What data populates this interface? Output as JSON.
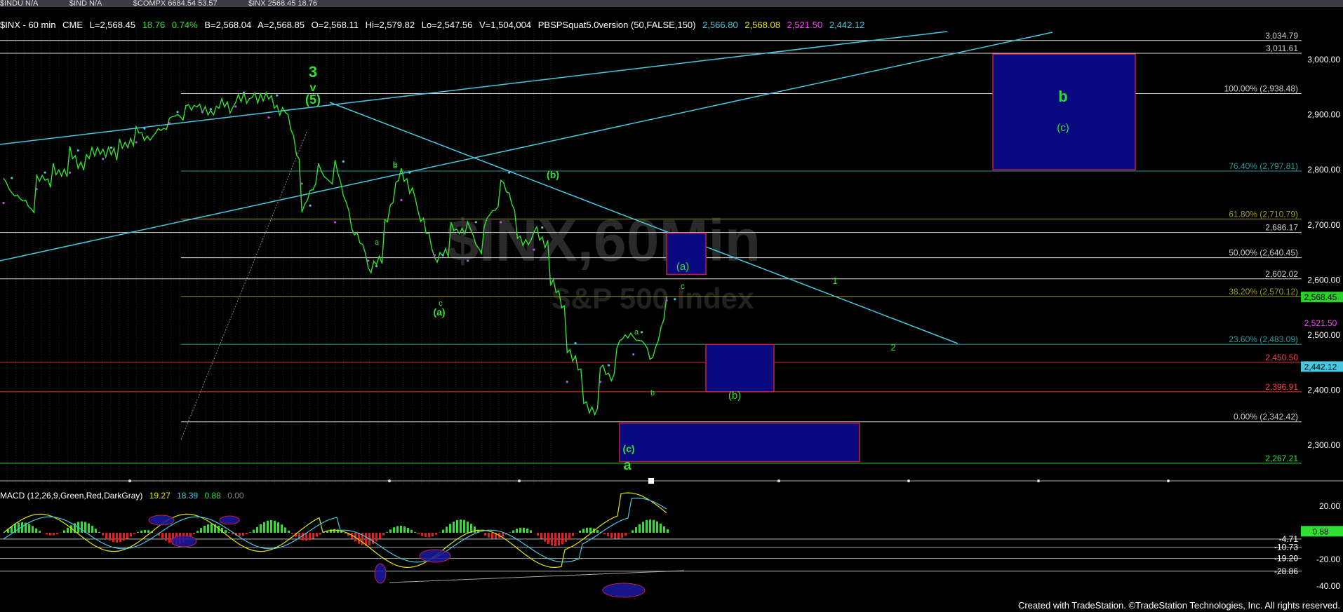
{
  "topbar": [
    "$INDU N/A",
    "$IND N/A",
    "$COMPX 6684.54 53.57",
    "$INX 2568.45 18.76"
  ],
  "header": {
    "symbol": "$INX - 60 min",
    "exchange": "CME",
    "last": "L=2,568.45",
    "change": "18.76",
    "pct": "0.74%",
    "bid": "B=2,568.04",
    "ask": "A=2,568.85",
    "open": "O=2,568.11",
    "high": "Hi=2,579.82",
    "low": "Lo=2,547.56",
    "volume": "V=1,504,004",
    "study": "PBSPSquat5.0version (50,FALSE,150)",
    "study_vals": [
      {
        "text": "2,566.80",
        "color": "#45c8e0"
      },
      {
        "text": "2,568.08",
        "color": "#e6e600"
      },
      {
        "text": "2,521.50",
        "color": "#ff40ff"
      },
      {
        "text": "2,442.12",
        "color": "#45c8e0"
      }
    ]
  },
  "watermark": {
    "title": "$INX,60Min",
    "subtitle": "S&P 500 Index"
  },
  "footer": "Created with TradeStation. ©TradeStation Technologies, Inc. All rights reserved.",
  "macd": {
    "label": "MACD (12,26,9,Green,Red,DarkGray)",
    "vals": [
      {
        "text": "19.27",
        "color": "#e6e600"
      },
      {
        "text": "18.39",
        "color": "#45c8e0"
      },
      {
        "text": "0.88",
        "color": "#30e030"
      },
      {
        "text": "0.00",
        "color": "#808080"
      }
    ],
    "axis": [
      "20.00",
      "-20.00",
      "-40.00"
    ],
    "levels": [
      "-4.71",
      "-10.73",
      "-19.20",
      "-28.86"
    ],
    "last_badge": "0.88"
  },
  "chart_data": {
    "type": "line",
    "title": "$INX - 60 min",
    "ylim": [
      2230,
      3060
    ],
    "y_ticks": [
      "3,000.00",
      "2,900.00",
      "2,800.00",
      "2,700.00",
      "2,600.00",
      "2,500.00",
      "2,400.00",
      "2,300.00"
    ],
    "levels": [
      {
        "label": "3,034.79",
        "value": 3034.79
      },
      {
        "label": "3,011.61",
        "value": 3011.61
      },
      {
        "label": "100.00% (2,938.48)",
        "value": 2938.48
      },
      {
        "label": "76.40% (2,797.81)",
        "value": 2797.81
      },
      {
        "label": "61.80% (2,710.79)",
        "value": 2710.79
      },
      {
        "label": "2,686.17",
        "value": 2686.17
      },
      {
        "label": "50.00% (2,640.45)",
        "value": 2640.45
      },
      {
        "label": "2,602.02",
        "value": 2602.02
      },
      {
        "label": "38.20% (2,570.12)",
        "value": 2570.12
      },
      {
        "label": "23.60% (2,483.09)",
        "value": 2483.09
      },
      {
        "label": "2,450.50",
        "value": 2450.5
      },
      {
        "label": "2,396.91",
        "value": 2396.91
      },
      {
        "label": "0.00% (2,342.42)",
        "value": 2342.42
      },
      {
        "label": "2,267.21",
        "value": 2267.21
      }
    ],
    "price_badges": [
      {
        "text": "2,568.45",
        "value": 2568.45,
        "bg": "#2ad02a",
        "fg": "#000"
      },
      {
        "text": "2,521.50",
        "value": 2521.5,
        "bg": "#000",
        "fg": "#ff40ff"
      },
      {
        "text": "2,442.12",
        "value": 2442.12,
        "bg": "#45c8e0",
        "fg": "#000"
      }
    ],
    "series": [
      {
        "color": "#30e030",
        "points": [
          [
            2780,
            2745
          ],
          [
            2745,
            2725
          ],
          [
            2790,
            2770
          ],
          [
            2805,
            2785
          ],
          [
            2830,
            2800
          ],
          [
            2820,
            2845
          ],
          [
            2835,
            2825
          ],
          [
            2850,
            2845
          ],
          [
            2870,
            2855
          ],
          [
            2860,
            2885
          ],
          [
            2900,
            2890
          ],
          [
            2920,
            2910
          ],
          [
            2905,
            2910
          ],
          [
            2920,
            2910
          ],
          [
            2935,
            2920
          ],
          [
            2938,
            2925
          ],
          [
            2930,
            2900
          ],
          [
            2910,
            2800
          ],
          [
            2730,
            2780
          ],
          [
            2810,
            2760
          ],
          [
            2810,
            2710
          ],
          [
            2690,
            2650
          ],
          [
            2620,
            2640
          ],
          [
            2700,
            2800
          ],
          [
            2790,
            2750
          ],
          [
            2720,
            2660
          ],
          [
            2640,
            2650
          ],
          [
            2700,
            2680
          ],
          [
            2700,
            2640
          ],
          [
            2700,
            2745
          ],
          [
            2790,
            2710
          ],
          [
            2680,
            2660
          ],
          [
            2690,
            2660
          ],
          [
            2600,
            2540
          ],
          [
            2480,
            2420
          ],
          [
            2380,
            2350
          ],
          [
            2440,
            2420
          ],
          [
            2480,
            2510
          ],
          [
            2500,
            2470
          ],
          [
            2450,
            2540
          ],
          [
            2560,
            2568
          ]
        ]
      }
    ],
    "wave_labels": [
      {
        "text": "3",
        "color": "#30e030",
        "size": 22,
        "bold": true
      },
      {
        "text": "v",
        "color": "#30e030",
        "size": 16,
        "bold": true
      },
      {
        "text": "(5)",
        "color": "#30e030",
        "size": 18,
        "bold": true
      },
      {
        "text": "b",
        "color": "#30e030",
        "size": 11
      },
      {
        "text": "a",
        "color": "#30e030",
        "size": 11
      },
      {
        "text": "c",
        "color": "#30e030",
        "size": 11
      },
      {
        "text": "(a)",
        "color": "#30e030",
        "size": 14,
        "bold": true
      },
      {
        "text": "b",
        "color": "#30e030",
        "size": 11
      },
      {
        "text": "(b)",
        "color": "#30e030",
        "size": 14,
        "bold": true
      },
      {
        "text": "a",
        "color": "#30e030",
        "size": 11
      },
      {
        "text": "b",
        "color": "#30e030",
        "size": 11
      },
      {
        "text": "(c)",
        "color": "#30e030",
        "size": 14,
        "bold": true
      },
      {
        "text": "a",
        "color": "#30e030",
        "size": 20,
        "bold": true
      },
      {
        "text": "1",
        "color": "#30e030",
        "size": 13
      },
      {
        "text": "2",
        "color": "#30e030",
        "size": 13
      }
    ],
    "boxes": [
      {
        "label": "b",
        "label2": "(c)",
        "ytop": 3010,
        "ybot": 2800
      },
      {
        "label": "(a)",
        "label2": "c",
        "ytop": 2685,
        "ybot": 2610
      },
      {
        "label": "(b)",
        "label2": "",
        "ytop": 2483,
        "ybot": 2397
      },
      {
        "label": "",
        "label2": "",
        "ytop": 2340,
        "ybot": 2270
      }
    ]
  }
}
